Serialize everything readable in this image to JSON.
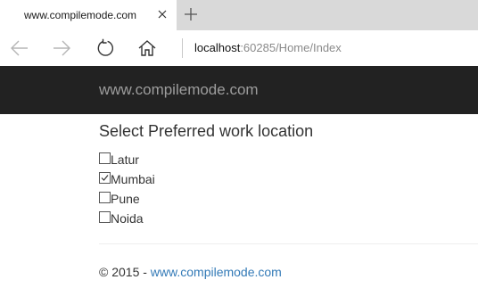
{
  "browser": {
    "tab": {
      "title": "www.compilemode.com"
    },
    "address": {
      "host": "localhost",
      "rest": ":60285/Home/Index"
    },
    "icons": {
      "close": "close-icon",
      "new_tab": "plus-icon",
      "back": "back-arrow-icon",
      "forward": "forward-arrow-icon",
      "refresh": "refresh-icon",
      "home": "home-icon"
    }
  },
  "header": {
    "brand": "www.compilemode.com"
  },
  "main": {
    "heading": "Select Preferred work location",
    "options": [
      {
        "label": "Latur",
        "checked": false
      },
      {
        "label": "Mumbai",
        "checked": true
      },
      {
        "label": "Pune",
        "checked": false
      },
      {
        "label": "Noida",
        "checked": false
      }
    ]
  },
  "footer": {
    "prefix": "© 2015 - ",
    "link": "www.compilemode.com"
  },
  "colors": {
    "header_bg": "#222222",
    "brand_text": "#9d9d9d",
    "link": "#337ab7"
  }
}
